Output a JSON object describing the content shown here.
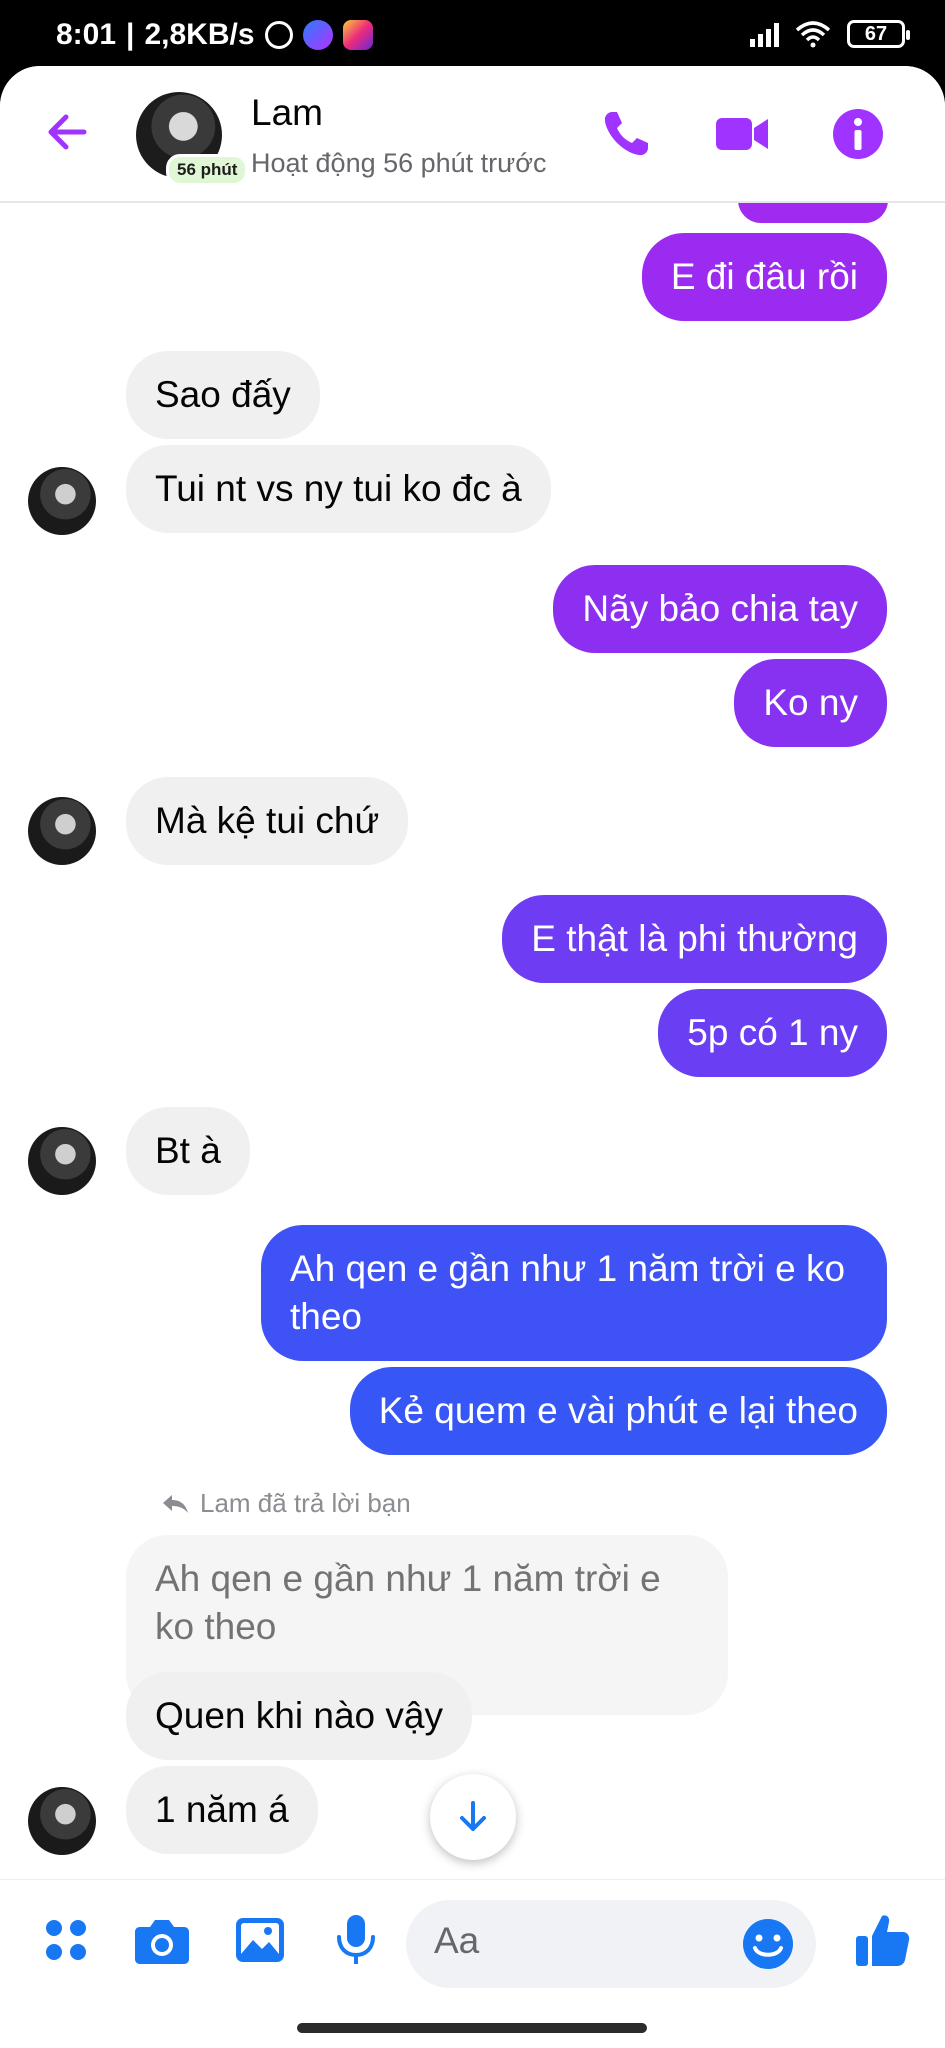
{
  "status_bar": {
    "time": "8:01",
    "net_speed": "2,8KB/s",
    "battery": "67"
  },
  "header": {
    "contact_name": "Lam",
    "active_badge": "56 phút",
    "status_text": "Hoạt động 56 phút trước"
  },
  "messages": [
    {
      "dir": "out",
      "text": "E đi đâu rồi",
      "color": "#9b2bf0"
    },
    {
      "dir": "in",
      "text": "Sao đấy"
    },
    {
      "dir": "in",
      "text": "Tui nt vs ny tui ko đc à"
    },
    {
      "dir": "out",
      "text": "Nãy bảo chia tay",
      "color": "#8c2ff0"
    },
    {
      "dir": "out",
      "text": "Ko ny",
      "color": "#8632f0"
    },
    {
      "dir": "in",
      "text": "Mà kệ tui chứ"
    },
    {
      "dir": "out",
      "text": "E thật là phi thường",
      "color": "#6e3cf2"
    },
    {
      "dir": "out",
      "text": "5p có 1 ny",
      "color": "#6a3ef2"
    },
    {
      "dir": "in",
      "text": "Bt à"
    },
    {
      "dir": "out",
      "text": "Ah qen e gần như 1 năm trời e ko theo",
      "color": "#3f52f5"
    },
    {
      "dir": "out",
      "text": "Kẻ quem e vài phút e lại theo",
      "color": "#3656f5"
    },
    {
      "dir": "in",
      "text": "Quen khi nào vậy"
    },
    {
      "dir": "in",
      "text": "1 năm á"
    }
  ],
  "reply": {
    "label": "Lam đã trả lời bạn",
    "quoted_text": "Ah qen e gần như 1 năm trời e ko theo"
  },
  "composer": {
    "placeholder": "Aa"
  },
  "colors": {
    "accent": "#a033ff",
    "blue": "#1877f2"
  }
}
